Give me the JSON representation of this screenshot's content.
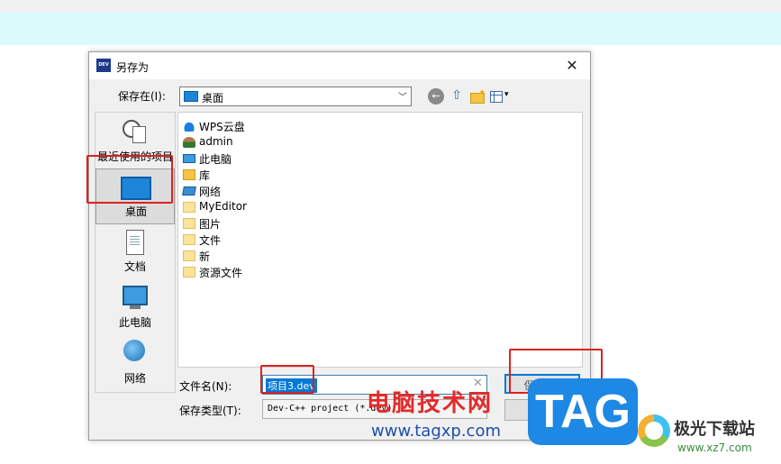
{
  "dialog": {
    "title": "另存为",
    "close_glyph": "✕",
    "app_icon_text": "DEV"
  },
  "toolbar": {
    "save_in_label": "保存在(I):",
    "save_in_value": "桌面",
    "back_glyph": "←",
    "up_glyph": "⇧",
    "view_glyph": "▾"
  },
  "places": [
    {
      "label": "最近使用的项目",
      "icon": "recent-items-icon"
    },
    {
      "label": "桌面",
      "icon": "desktop-icon"
    },
    {
      "label": "文档",
      "icon": "documents-icon"
    },
    {
      "label": "此电脑",
      "icon": "this-pc-icon"
    },
    {
      "label": "网络",
      "icon": "network-icon"
    }
  ],
  "files": [
    {
      "name": "WPS云盘",
      "icon": "cloud-icon"
    },
    {
      "name": "admin",
      "icon": "user-icon"
    },
    {
      "name": "此电脑",
      "icon": "computer-icon"
    },
    {
      "name": "库",
      "icon": "library-icon"
    },
    {
      "name": "网络",
      "icon": "network-icon"
    },
    {
      "name": "MyEditor",
      "icon": "folder-icon"
    },
    {
      "name": "图片",
      "icon": "folder-icon"
    },
    {
      "name": "文件",
      "icon": "folder-icon"
    },
    {
      "name": "新",
      "icon": "folder-icon"
    },
    {
      "name": "资源文件",
      "icon": "folder-icon"
    }
  ],
  "form": {
    "filename_label": "文件名(N):",
    "filename_value": "项目3.dev",
    "filetype_label": "保存类型(T):",
    "filetype_value": "Dev-C++ project (*.dev)",
    "save_button": "保存(S)",
    "cancel_button": "取消",
    "clear_glyph": "✕"
  },
  "watermark": {
    "brand_text": "电脑技术网",
    "url": "www.tagxp.com",
    "tag": "TAG",
    "site_name": "极光下载站",
    "site_url": "www.xz7.com"
  },
  "colors": {
    "highlight_red": "#e0201e",
    "selection_blue": "#0078d7",
    "cyan_bar": "#d9fbfb"
  }
}
